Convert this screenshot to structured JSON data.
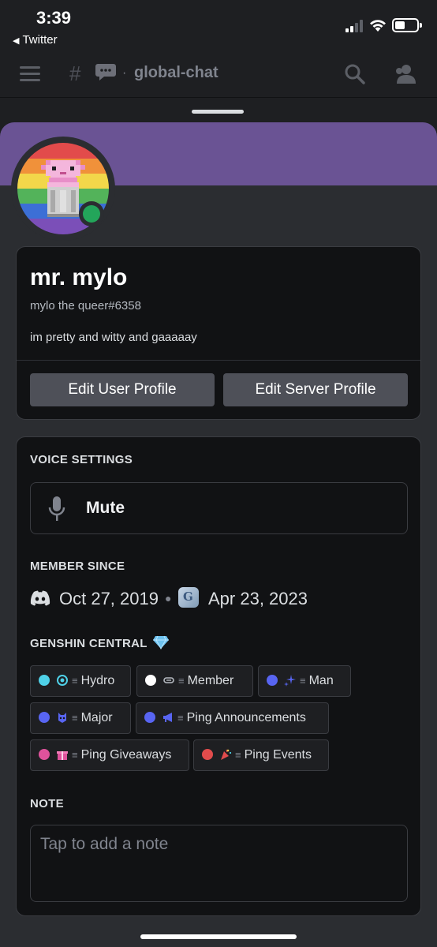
{
  "status_bar": {
    "time": "3:39",
    "back_app": "Twitter"
  },
  "channel": {
    "name": "global-chat"
  },
  "profile": {
    "display_name": "mr. mylo",
    "username": "mylo the queer#6358",
    "bio": "im pretty and witty and gaaaaay",
    "status": "online",
    "banner_color": "#6a5394",
    "edit_user_profile": "Edit User Profile",
    "edit_server_profile": "Edit Server Profile"
  },
  "voice_settings": {
    "title": "VOICE SETTINGS",
    "mute_label": "Mute"
  },
  "member_since": {
    "title": "MEMBER SINCE",
    "discord_date": "Oct 27, 2019",
    "server_date": "Apr 23, 2023"
  },
  "server": {
    "title": "GENSHIN CENTRAL",
    "roles": [
      {
        "name": "Hydro",
        "color": "#4fd1e8",
        "icon": "hydro-icon"
      },
      {
        "name": "Member",
        "color": "#ffffff",
        "icon": "member-icon"
      },
      {
        "name": "Man",
        "color": "#5865f2",
        "icon": "sparkle-icon"
      },
      {
        "name": "Major",
        "color": "#5865f2",
        "icon": "major-icon"
      },
      {
        "name": "Ping Announcements",
        "color": "#5865f2",
        "icon": "megaphone-icon"
      },
      {
        "name": "Ping Giveaways",
        "color": "#e0529c",
        "icon": "gift-icon"
      },
      {
        "name": "Ping Events",
        "color": "#e24c4c",
        "icon": "party-icon"
      }
    ]
  },
  "note": {
    "title": "NOTE",
    "placeholder": "Tap to add a note"
  }
}
